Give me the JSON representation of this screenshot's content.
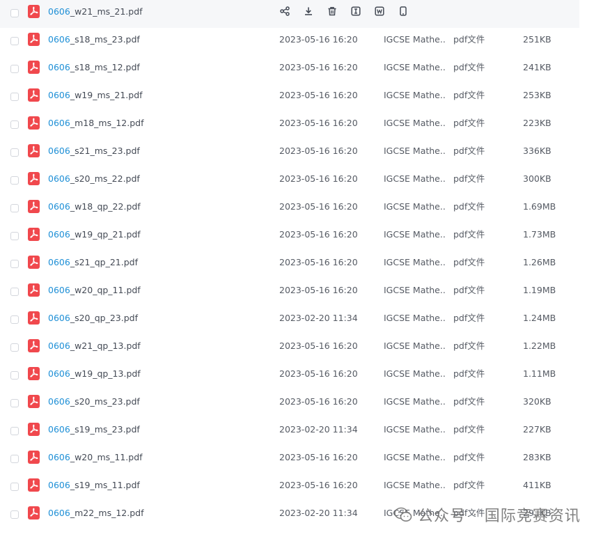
{
  "file_list": {
    "common": {
      "source": "IGCSE Mathe...",
      "type": "pdf文件",
      "prefix": "0606"
    },
    "hover_actions": [
      {
        "name": "share-icon"
      },
      {
        "name": "download-icon"
      },
      {
        "name": "delete-icon"
      },
      {
        "name": "rename-icon"
      },
      {
        "name": "convert-word-icon"
      },
      {
        "name": "mobile-icon"
      }
    ],
    "rows": [
      {
        "suffix": "_w21_ms_21.pdf"
      },
      {
        "suffix": "_s18_ms_23.pdf",
        "date": "2023-05-16 16:20",
        "size": "251KB"
      },
      {
        "suffix": "_s18_ms_12.pdf",
        "date": "2023-05-16 16:20",
        "size": "241KB"
      },
      {
        "suffix": "_w19_ms_21.pdf",
        "date": "2023-05-16 16:20",
        "size": "253KB"
      },
      {
        "suffix": "_m18_ms_12.pdf",
        "date": "2023-05-16 16:20",
        "size": "223KB"
      },
      {
        "suffix": "_s21_ms_23.pdf",
        "date": "2023-05-16 16:20",
        "size": "336KB"
      },
      {
        "suffix": "_s20_ms_22.pdf",
        "date": "2023-05-16 16:20",
        "size": "300KB"
      },
      {
        "suffix": "_w18_qp_22.pdf",
        "date": "2023-05-16 16:20",
        "size": "1.69MB"
      },
      {
        "suffix": "_w19_qp_21.pdf",
        "date": "2023-05-16 16:20",
        "size": "1.73MB"
      },
      {
        "suffix": "_s21_qp_21.pdf",
        "date": "2023-05-16 16:20",
        "size": "1.26MB"
      },
      {
        "suffix": "_w20_qp_11.pdf",
        "date": "2023-05-16 16:20",
        "size": "1.19MB"
      },
      {
        "suffix": "_s20_qp_23.pdf",
        "date": "2023-02-20 11:34",
        "size": "1.24MB"
      },
      {
        "suffix": "_w21_qp_13.pdf",
        "date": "2023-05-16 16:20",
        "size": "1.22MB"
      },
      {
        "suffix": "_w19_qp_13.pdf",
        "date": "2023-05-16 16:20",
        "size": "1.11MB"
      },
      {
        "suffix": "_s20_ms_23.pdf",
        "date": "2023-05-16 16:20",
        "size": "320KB"
      },
      {
        "suffix": "_s19_ms_23.pdf",
        "date": "2023-02-20 11:34",
        "size": "227KB"
      },
      {
        "suffix": "_w20_ms_11.pdf",
        "date": "2023-05-16 16:20",
        "size": "283KB"
      },
      {
        "suffix": "_s19_ms_11.pdf",
        "date": "2023-05-16 16:20",
        "size": "411KB"
      },
      {
        "suffix": "_m22_ms_12.pdf",
        "date": "2023-02-20 11:34",
        "size": "29..KB"
      }
    ]
  },
  "watermark": {
    "account": "公众号",
    "sep": "·",
    "name": "国际竞赛资讯"
  }
}
